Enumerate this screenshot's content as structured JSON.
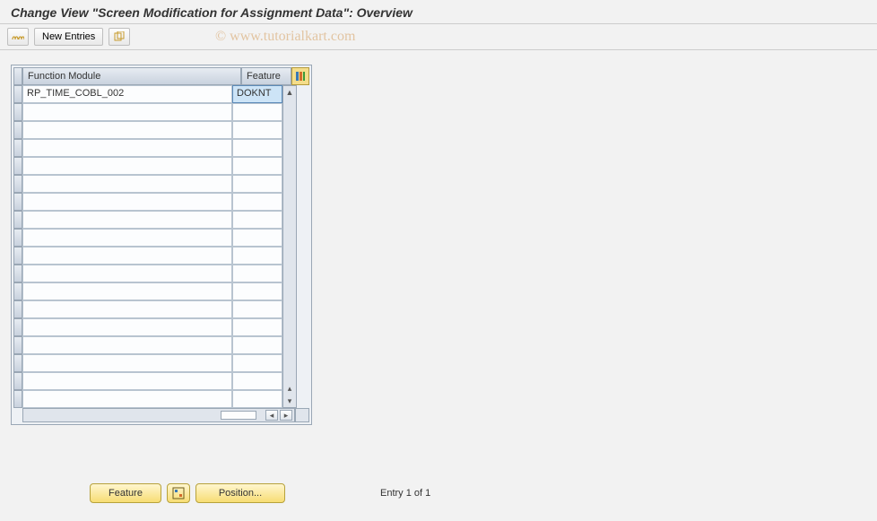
{
  "title": "Change View \"Screen Modification for Assignment Data\": Overview",
  "toolbar": {
    "new_entries_label": "New Entries"
  },
  "watermark": "© www.tutorialkart.com",
  "table": {
    "headers": {
      "function_module": "Function Module",
      "feature": "Feature"
    },
    "rows": [
      {
        "function_module": "RP_TIME_COBL_002",
        "feature": "DOKNT"
      }
    ],
    "empty_rows": 17
  },
  "footer": {
    "feature_btn": "Feature",
    "position_btn": "Position...",
    "status": "Entry 1 of 1"
  }
}
